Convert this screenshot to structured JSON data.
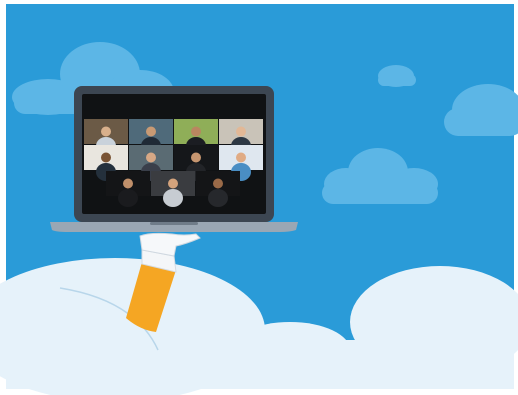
{
  "scene": {
    "sky_color": "#2a9bd8",
    "cloud_light": "#5cb6e6",
    "cloud_white": "#e6f2fa",
    "laptop_frame": "#3c4652",
    "laptop_screen": "#101214",
    "laptop_base": "#9aa7b4",
    "sleeve_color": "#f5a623",
    "cuff_color": "#f4f6f8",
    "hand_color": "#f6f8fa"
  },
  "video_grid": {
    "rows": 3,
    "tiles": [
      {
        "name": "participant-1",
        "bg": "#6b5a46",
        "skin": "#d8b08c",
        "shirt": "#c9d2db"
      },
      {
        "name": "participant-2",
        "bg": "#4f6a7a",
        "skin": "#c89a74",
        "shirt": "#1f2a36"
      },
      {
        "name": "participant-3",
        "bg": "#8fae58",
        "skin": "#b98660",
        "shirt": "#1b1d22"
      },
      {
        "name": "participant-4",
        "bg": "#c9c3b8",
        "skin": "#e2b896",
        "shirt": "#2d3844"
      },
      {
        "name": "participant-5",
        "bg": "#e9e6df",
        "skin": "#7a5434",
        "shirt": "#24303c"
      },
      {
        "name": "participant-6",
        "bg": "#5a6b73",
        "skin": "#d7a885",
        "shirt": "#3a3f4a"
      },
      {
        "name": "participant-7",
        "bg": "#15171a",
        "skin": "#c79670",
        "shirt": "#222428"
      },
      {
        "name": "participant-8",
        "bg": "#dfe7ef",
        "skin": "#e0ab84",
        "shirt": "#4a8ec4"
      },
      {
        "name": "participant-9",
        "bg": "#141517",
        "skin": "#bf8f6a",
        "shirt": "#1a1b1e"
      },
      {
        "name": "participant-10",
        "bg": "#3a3c40",
        "skin": "#d4a37c",
        "shirt": "#c7ccd2"
      },
      {
        "name": "participant-11",
        "bg": "#141517",
        "skin": "#9a6a48",
        "shirt": "#26282c"
      }
    ]
  }
}
